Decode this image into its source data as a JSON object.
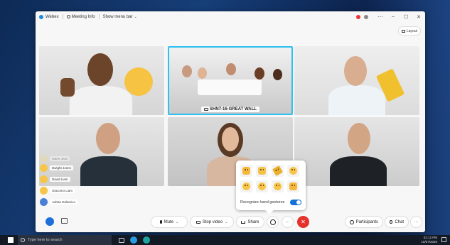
{
  "titlebar": {
    "app_name": "Webex",
    "meeting_info": "Meeting Info",
    "show_menu_bar": "Show menu bar"
  },
  "layout_button": "Layout",
  "tiles": {
    "center_label": "SHN7-16-GREAT WALL"
  },
  "reactions": [
    {
      "name": "Marie Jean",
      "emoji": "thumb",
      "faded": true
    },
    {
      "name": "Dwight Jones",
      "emoji": "thumb",
      "faded": false
    },
    {
      "name": "David Liam",
      "emoji": "smile",
      "faded": false
    },
    {
      "name": "Giacomo Liam",
      "emoji": "thumb",
      "faded": false
    },
    {
      "name": "Adrian Delamico",
      "emoji": "party",
      "faded": false
    }
  ],
  "reaction_popup": {
    "label": "Recognize hand gestures",
    "toggle_on": true,
    "emojis": [
      "thumbs-up",
      "clap",
      "party",
      "smile",
      "laugh",
      "surprised",
      "sad",
      "thumbs-down"
    ]
  },
  "bottom_bar": {
    "mute": "Mute",
    "stop_video": "Stop video",
    "share": "Share",
    "participants": "Participants",
    "chat": "Chat",
    "more": "···",
    "end": "✕"
  },
  "taskbar": {
    "search_placeholder": "Type here to search",
    "time": "02:12 PM",
    "date": "15/07/2020"
  },
  "colors": {
    "active_border": "#2dc0f0",
    "end_button": "#e5322d",
    "toggle": "#1570d8"
  }
}
